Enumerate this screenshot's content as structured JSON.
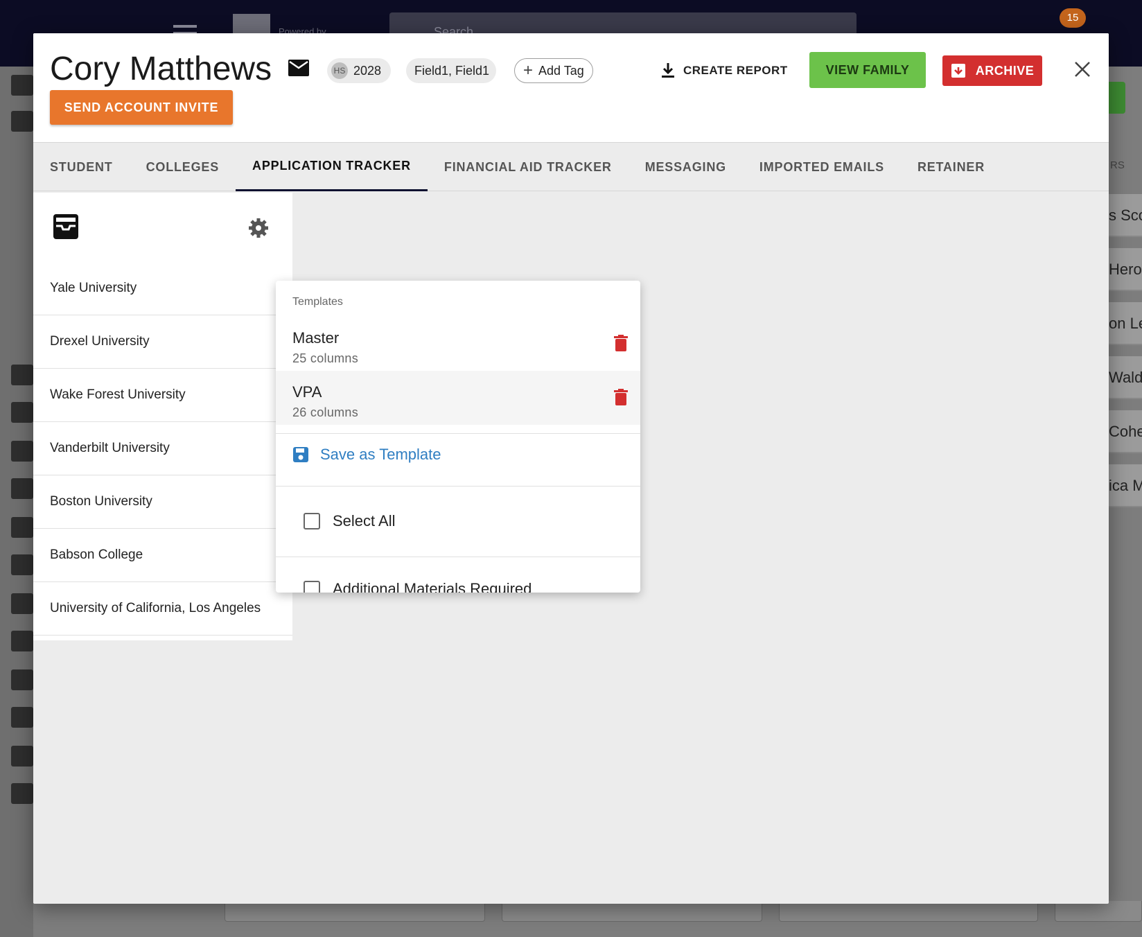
{
  "background": {
    "search_placeholder": "Search",
    "powered_by": "Powered by",
    "notification_count": "15",
    "right_column_header": "RS",
    "right_column_rows": [
      "s Sco",
      "Hero",
      "on Le",
      "Walde",
      "Cohe",
      "ica M"
    ]
  },
  "header": {
    "student_name": "Cory Matthews",
    "grad_prefix": "HS",
    "grad_year": "2028",
    "fields_chip": "Field1, Field1",
    "add_tag_label": "Add Tag",
    "create_report_label": "CREATE REPORT",
    "view_family_label": "VIEW FAMILY",
    "archive_label": "ARCHIVE",
    "send_invite_label": "SEND ACCOUNT INVITE",
    "colors": {
      "view_family": "#6cc24a",
      "archive": "#d32f2f",
      "invite": "#e8762c"
    }
  },
  "tabs": [
    {
      "label": "STUDENT"
    },
    {
      "label": "COLLEGES"
    },
    {
      "label": "APPLICATION TRACKER",
      "active": true
    },
    {
      "label": "FINANCIAL AID TRACKER"
    },
    {
      "label": "MESSAGING"
    },
    {
      "label": "IMPORTED EMAILS"
    },
    {
      "label": "RETAINER"
    }
  ],
  "colleges": [
    "Yale University",
    "Drexel University",
    "Wake Forest University",
    "Vanderbilt University",
    "Boston University",
    "Babson College",
    "University of California, Los Angeles"
  ],
  "columns_menu": {
    "subheader": "Templates",
    "templates": [
      {
        "name": "Master",
        "columns": "25 columns"
      },
      {
        "name": "VPA",
        "columns": "26 columns"
      }
    ],
    "save_template_label": "Save as Template",
    "select_all_label": "Select All",
    "first_column_label": "Additional Materials Required"
  }
}
